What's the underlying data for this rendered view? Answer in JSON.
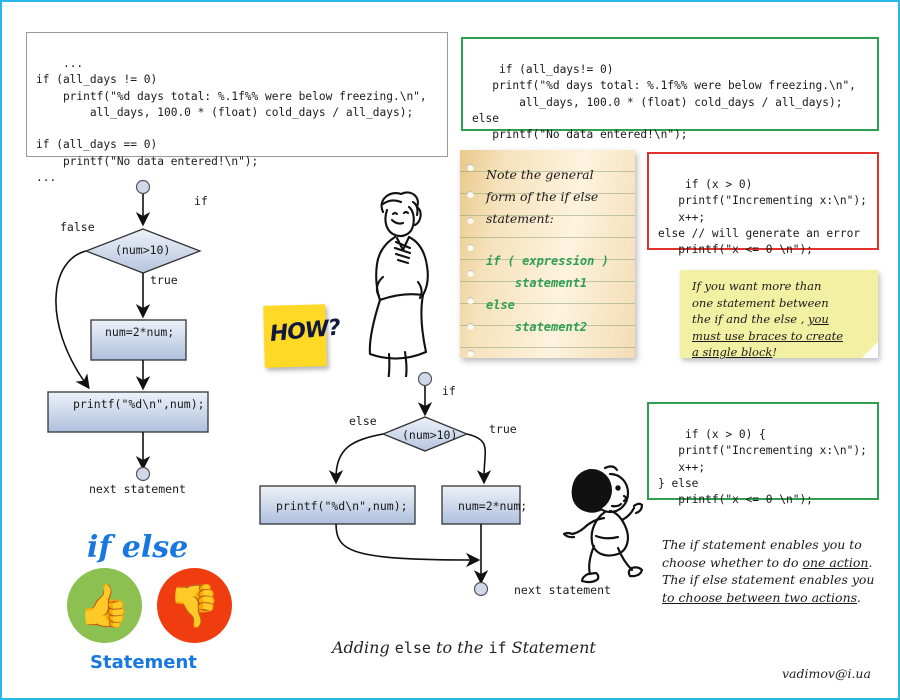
{
  "page": {
    "border_color": "#29b6e8",
    "caption": "Adding else to the if Statement",
    "caption_mono": "else",
    "caption_mono2": "if",
    "caption_pre": "Adding ",
    "caption_mid": " to the ",
    "caption_post": " Statement",
    "signature": "vadimov@i.ua"
  },
  "code_blocks": {
    "top_left": {
      "border_color": "#9a9a9a",
      "text": "...\nif (all_days != 0)\n    printf(\"%d days total: %.1f%% were below freezing.\\n\",\n        all_days, 100.0 * (float) cold_days / all_days);\n\nif (all_days == 0)\n    printf(\"No data entered!\\n\");\n..."
    },
    "top_right": {
      "border_color": "#2f9e4f",
      "text": "if (all_days!= 0)\n   printf(\"%d days total: %.1f%% were below freezing.\\n\",\n       all_days, 100.0 * (float) cold_days / all_days);\nelse\n   printf(\"No data entered!\\n\");"
    },
    "error_example": {
      "border_color": "#e0312a",
      "text": "if (x > 0)\n   printf(\"Incrementing x:\\n\");\n   x++;\nelse // will generate an error\n   printf(\"x <= 0 \\n\");"
    },
    "braces_example": {
      "border_color": "#2f9e4f",
      "text": "if (x > 0) {\n   printf(\"Incrementing x:\\n\");\n   x++;\n} else\n   printf(\"x <= 0 \\n\");"
    }
  },
  "notepad": {
    "line1": "Note the general",
    "line2": "form of the if else",
    "line3": "statement:",
    "code": "if ( expression )\n    statement1\nelse\n    statement2",
    "code_color": "#2e9e54"
  },
  "tip_note": {
    "background": "#f2f0a2",
    "plain1": "If you want more than",
    "plain2": "one statement between",
    "plain3": "the if and the else , ",
    "underlined1": "you",
    "underlined2": "must use braces to create",
    "underlined3": "a single block",
    "tail": "!"
  },
  "how_note": {
    "background": "#ffd925",
    "text": "HOW?"
  },
  "summary": {
    "line1": "The if statement enables you to",
    "line2a": "choose whether to do ",
    "line2b": "one action",
    "line2c": ".",
    "line3": "The if else statement enables you",
    "line4a": "to choose between two actions",
    "line4b": "."
  },
  "logo": {
    "title": "if else",
    "subtitle": "Statement",
    "title_color": "#1878e0",
    "thumb_up_color": "#8cc152",
    "thumb_down_color": "#f03d10",
    "thumb_up_glyph": "👍",
    "thumb_down_glyph": "👎"
  },
  "flowchart_if": {
    "start_label": "if",
    "condition": "(num>10)",
    "false_label": "false",
    "true_label": "true",
    "action_box": "num=2*num;",
    "print_box": "printf(\"%d\\n\",num);",
    "end_label": "next statement",
    "box_fill_top": "#e8eef8",
    "box_fill_bottom": "#aebedb",
    "box_stroke": "#333333"
  },
  "flowchart_if_else": {
    "start_label": "if",
    "condition": "(num>10)",
    "else_label": "else",
    "true_label": "true",
    "else_box": "printf(\"%d\\n\",num);",
    "true_box": "num=2*num;",
    "end_label": "next statement"
  }
}
